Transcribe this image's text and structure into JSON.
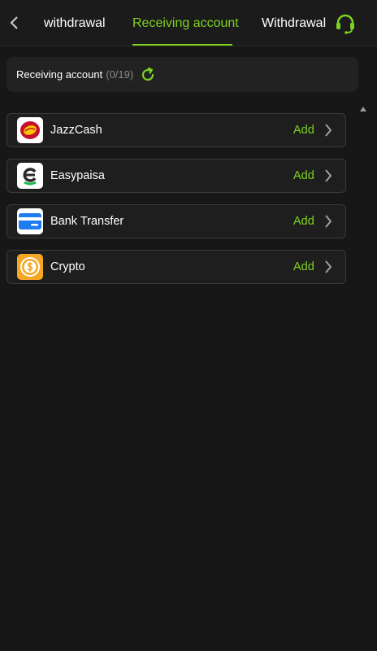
{
  "header": {
    "tabs": [
      {
        "label": "withdrawal",
        "active": false
      },
      {
        "label": "Receiving account",
        "active": true
      },
      {
        "label": "Withdrawal",
        "active": false
      }
    ],
    "back_icon": "chevron-left-icon",
    "support_icon": "headset-icon"
  },
  "summary": {
    "label": "Receiving account",
    "count": "(0/19)",
    "refresh_icon": "refresh-icon"
  },
  "accounts": [
    {
      "name": "JazzCash",
      "action": "Add",
      "logo_icon": "jazzcash-logo-icon"
    },
    {
      "name": "Easypaisa",
      "action": "Add",
      "logo_icon": "easypaisa-logo-icon"
    },
    {
      "name": "Bank Transfer",
      "action": "Add",
      "logo_icon": "bank-card-icon"
    },
    {
      "name": "Crypto",
      "action": "Add",
      "logo_icon": "crypto-coin-icon"
    }
  ],
  "colors": {
    "accent": "#7ed321",
    "background": "#171717",
    "card": "#1e1e1e",
    "border": "#3a3a3a"
  }
}
